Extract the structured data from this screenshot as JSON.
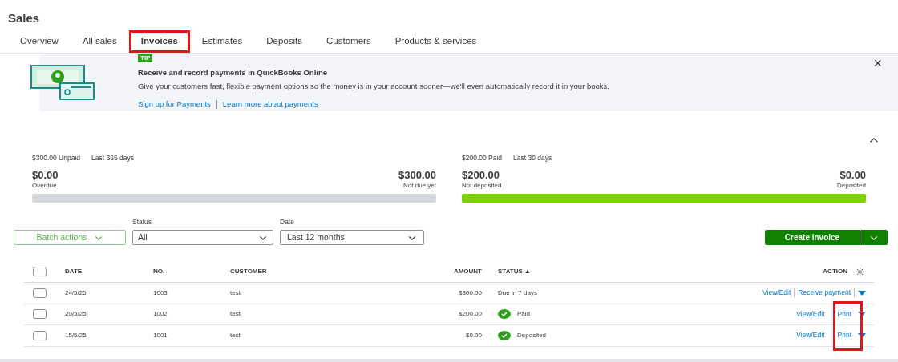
{
  "page_title": "Sales",
  "tabs": [
    {
      "label": "Overview",
      "selected": false,
      "outlined": false
    },
    {
      "label": "All sales",
      "selected": false,
      "outlined": false
    },
    {
      "label": "Invoices",
      "selected": true,
      "outlined": true
    },
    {
      "label": "Estimates",
      "selected": false,
      "outlined": false
    },
    {
      "label": "Deposits",
      "selected": false,
      "outlined": false
    },
    {
      "label": "Customers",
      "selected": false,
      "outlined": false
    },
    {
      "label": "Products & services",
      "selected": false,
      "outlined": false
    }
  ],
  "tip_banner": {
    "badge": "TIP",
    "title": "Receive and record payments in QuickBooks Online",
    "body": "Give your customers fast, flexible payment options so the money is in your account sooner—we'll even automatically record it in your books.",
    "links": [
      "Sign up for Payments",
      "Learn more about payments"
    ],
    "close": "×"
  },
  "summaries": [
    {
      "headline": "$300.00 Unpaid",
      "period": "Last 365 days",
      "left_amount": "$0.00",
      "left_label": "Overdue",
      "right_amount": "$300.00",
      "right_label": "Not due yet",
      "color": "#d4d7dc"
    },
    {
      "headline": "$200.00 Paid",
      "period": "Last 30 days",
      "left_amount": "$200.00",
      "left_label": "Not deposited",
      "right_amount": "$0.00",
      "right_label": "Deposited",
      "color": "#7fd000"
    }
  ],
  "filters": {
    "batch_actions": "Batch actions",
    "status": {
      "label": "Status",
      "value": "All"
    },
    "date": {
      "label": "Date",
      "value": "Last 12 months"
    },
    "create_button": "Create invoice"
  },
  "table": {
    "select_all_checked": false,
    "columns": [
      "DATE",
      "NO.",
      "CUSTOMER",
      "AMOUNT",
      "STATUS ▲",
      "ACTION"
    ],
    "rows": [
      {
        "checked": false,
        "date": "24/5/25",
        "no": "1003",
        "customer": "test",
        "amount": "$300.00",
        "status": "Due in 7 days",
        "status_done": false,
        "actions": [
          "View/Edit",
          "Receive payment"
        ]
      },
      {
        "checked": false,
        "date": "20/5/25",
        "no": "1002",
        "customer": "test",
        "amount": "$200.00",
        "status": "Paid",
        "status_done": true,
        "actions": [
          "View/Edit",
          "Print"
        ]
      },
      {
        "checked": false,
        "date": "15/5/25",
        "no": "1001",
        "customer": "test",
        "amount": "$0.00",
        "status": "Deposited",
        "status_done": true,
        "actions": [
          "View/Edit",
          "Print"
        ]
      }
    ],
    "print_outlined": true
  }
}
